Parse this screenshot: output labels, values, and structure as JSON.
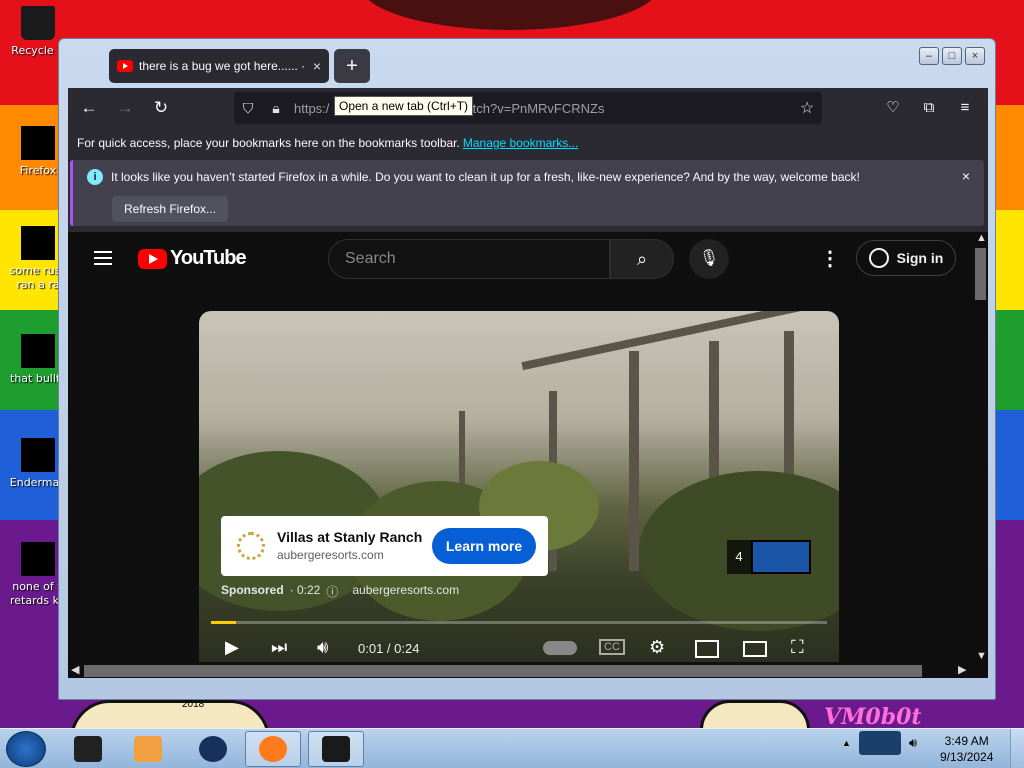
{
  "desktop": {
    "icons": [
      {
        "label": "Recycle B"
      },
      {
        "label": "Firefox"
      },
      {
        "label": "some russ"
      },
      {
        "label": "ran a ra"
      },
      {
        "label": "that bullts"
      },
      {
        "label": "Enderman"
      },
      {
        "label": "none of y"
      },
      {
        "label": "retards kn"
      }
    ],
    "wallpaper_text": "VM0b0t",
    "wallpaper_small": "2018"
  },
  "browser": {
    "tab": {
      "title": "there is a bug we got here...... ·",
      "close": "×"
    },
    "new_tab_label": "+",
    "tooltip": "Open a new tab (Ctrl+T)",
    "url_visible_left": "https:/",
    "url_visible_right": "atch?v=PnMRvFCRNZs",
    "bookmarks_text": "For quick access, place your bookmarks here on the bookmarks toolbar.",
    "bookmarks_link": "Manage bookmarks...",
    "notification": {
      "message": "It looks like you haven’t started Firefox in a while. Do you want to clean it up for a fresh, like-new experience? And by the way, welcome back!",
      "button": "Refresh Firefox...",
      "close": "×"
    },
    "window_controls": [
      "–",
      "□",
      "×"
    ]
  },
  "youtube": {
    "logo_text": "YouTube",
    "search_placeholder": "Search",
    "more": "⋮",
    "sign_in": "Sign in",
    "ad": {
      "advertiser": "Villas at Stanly Ranch",
      "domain": "aubergeresorts.com",
      "cta": "Learn more",
      "sponsored": "Sponsored",
      "duration": "· 0:22",
      "info_icon": "ⓘ",
      "url": "aubergeresorts.com",
      "skip_count": "4"
    },
    "player": {
      "time": "0:01 / 0:24",
      "progress": 0.04
    }
  },
  "taskbar": {
    "clock_time": "3:49 AM",
    "clock_date": "9/13/2024"
  },
  "colors": {
    "firefox_bg": "#2b2a33",
    "youtube_bg": "#0f0f0f",
    "accent_blue": "#065fd4",
    "ad_progress": "#ffcc00",
    "link": "#00ddff"
  }
}
